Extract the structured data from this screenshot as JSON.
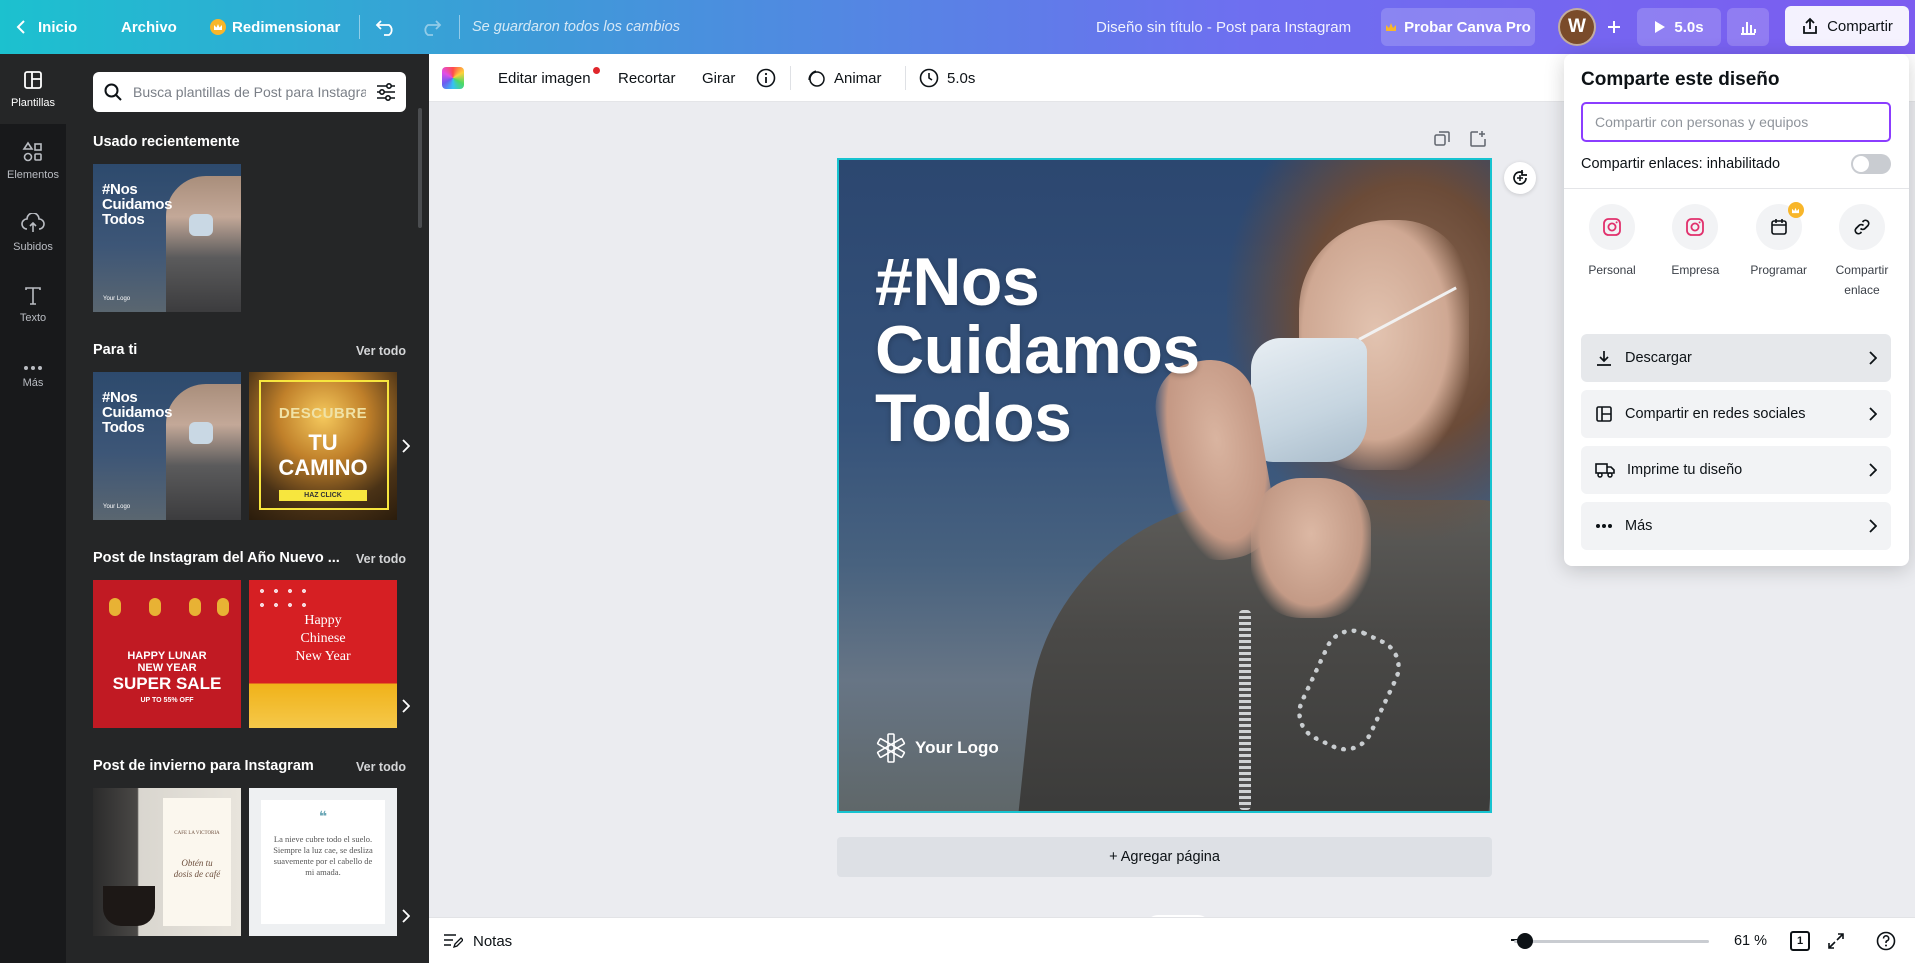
{
  "topbar": {
    "home": "Inicio",
    "file": "Archivo",
    "resize": "Redimensionar",
    "saved": "Se guardaron todos los cambios",
    "doc_title": "Diseño sin título - Post para Instagram",
    "try_pro": "Probar Canva Pro",
    "avatar_initial": "W",
    "play_duration": "5.0s",
    "share": "Compartir"
  },
  "rail": {
    "items": [
      {
        "label": "Plantillas",
        "icon": "templates-icon"
      },
      {
        "label": "Elementos",
        "icon": "elements-icon"
      },
      {
        "label": "Subidos",
        "icon": "upload-icon"
      },
      {
        "label": "Texto",
        "icon": "text-icon"
      },
      {
        "label": "Más",
        "icon": "more-icon"
      }
    ]
  },
  "panel": {
    "search_placeholder": "Busca plantillas de Post para Instagram",
    "sections": [
      {
        "title": "Usado recientemente",
        "link": ""
      },
      {
        "title": "Para ti",
        "link": "Ver todo"
      },
      {
        "title": "Post de Instagram del Año Nuevo ...",
        "link": "Ver todo"
      },
      {
        "title": "Post de invierno para Instagram",
        "link": "Ver todo"
      }
    ],
    "thumbs": {
      "mask_lines": [
        "#Nos",
        "Cuidamos",
        "Todos"
      ],
      "mask_logo": "Your Logo",
      "camino": [
        "DESCUBRE",
        "TU",
        "CAMINO",
        "HAZ CLICK"
      ],
      "lunar": [
        "HAPPY LUNAR",
        "NEW YEAR",
        "SUPER SALE",
        "UP TO 55% OFF"
      ],
      "chinese": [
        "Happy",
        "Chinese",
        "New Year"
      ],
      "coffee": [
        "Obtén tu",
        "dosis de café"
      ],
      "coffee_small": "CAFE LA VICTORIA",
      "snow": "La nieve cubre todo el suelo. Siempre la luz cae, se desliza suavemente por el cabello de mi amada."
    }
  },
  "editor_toolbar": {
    "edit_image": "Editar imagen",
    "crop": "Recortar",
    "rotate": "Girar",
    "animate": "Animar",
    "duration": "5.0s"
  },
  "design": {
    "headline": [
      "#Nos",
      "Cuidamos",
      "Todos"
    ],
    "logo": "Your Logo"
  },
  "canvas": {
    "add_page": "+ Agregar página"
  },
  "bottombar": {
    "notes": "Notas",
    "zoom": "61 %",
    "page_number": "1",
    "zoom_level": 0.61
  },
  "share_popup": {
    "title": "Comparte este diseño",
    "input_placeholder": "Compartir con personas y equipos",
    "link_sharing": "Compartir enlaces: inhabilitado",
    "options": [
      {
        "label": "Personal",
        "icon": "instagram-icon"
      },
      {
        "label": "Empresa",
        "icon": "instagram-icon"
      },
      {
        "label": "Programar",
        "icon": "calendar-icon"
      },
      {
        "label": "Compartir enlace",
        "icon": "link-icon"
      }
    ],
    "rows": [
      {
        "label": "Descargar",
        "icon": "download-icon"
      },
      {
        "label": "Compartir en redes sociales",
        "icon": "social-icon"
      },
      {
        "label": "Imprime tu diseño",
        "icon": "print-truck-icon"
      },
      {
        "label": "Más",
        "icon": "more-dots-icon"
      }
    ]
  },
  "colors": {
    "accent_purple": "#8b3dff",
    "selection_cyan": "#17c3d0",
    "panel_dark": "#252627",
    "rail_dark": "#18191b"
  }
}
